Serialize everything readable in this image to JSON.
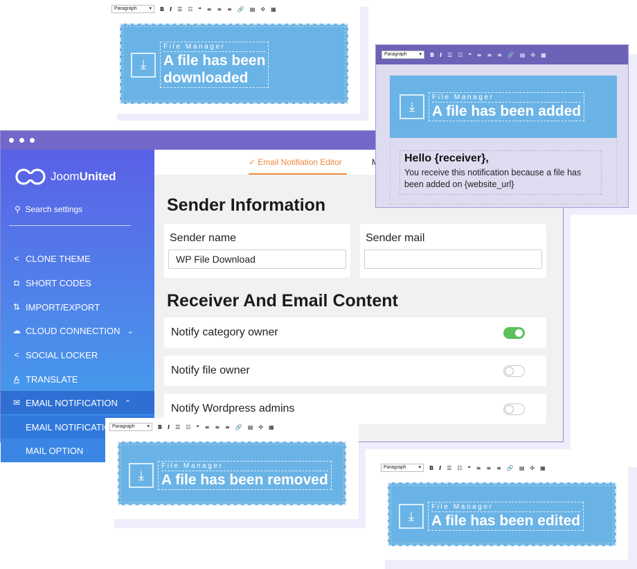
{
  "toolbar": {
    "paragraph_label": "Paragraph",
    "bold": "B",
    "italic": "I",
    "ul": "☰",
    "ol": "☷",
    "quote": "❝",
    "align_left": "≡",
    "align_center": "≡",
    "align_right": "≡",
    "link": "🔗",
    "hr": "▤",
    "fullscreen": "✣",
    "table": "▦"
  },
  "banners": {
    "downloaded": {
      "subtitle": "File Manager",
      "title_line1": "A file has been",
      "title_line2": "downloaded"
    },
    "added": {
      "subtitle": "File Manager",
      "title": "A file has been added",
      "greeting": "Hello {receiver},",
      "body": "You receive this notification because a file has been added on {website_url}"
    },
    "removed": {
      "subtitle": "File Manager",
      "title": "A file has been removed"
    },
    "edited": {
      "subtitle": "File Manager",
      "title": "A file has been edited"
    }
  },
  "app": {
    "logo": {
      "brand_light": "Joom",
      "brand_bold": "United"
    },
    "search_placeholder": "Search settings",
    "nav": [
      {
        "label": "CLONE THEME",
        "icon": "share-icon"
      },
      {
        "label": "SHORT CODES",
        "icon": "shortcode-icon"
      },
      {
        "label": "IMPORT/EXPORT",
        "icon": "import-export-icon"
      },
      {
        "label": "CLOUD CONNECTION",
        "icon": "cloud-icon"
      },
      {
        "label": "SOCIAL LOCKER",
        "icon": "share-icon"
      },
      {
        "label": "TRANSLATE",
        "icon": "translate-icon"
      },
      {
        "label": "EMAIL NOTIFICATION",
        "icon": "mail-icon"
      },
      {
        "label": "EMAIL NOTIFICATION EDITOR"
      },
      {
        "label": "MAIL OPTION"
      }
    ],
    "tabs": {
      "active": "Email Notifiation Editor",
      "next": "M"
    },
    "sender_heading": "Sender Information",
    "sender_name_label": "Sender name",
    "sender_name_value": "WP File Download",
    "sender_mail_label": "Sender mail",
    "sender_mail_value": "",
    "receiver_heading": "Receiver And Email Content",
    "toggles": [
      {
        "label": "Notify category owner",
        "on": true
      },
      {
        "label": "Notify file owner",
        "on": false
      },
      {
        "label": "Notify Wordpress admins",
        "on": false
      }
    ]
  },
  "colors": {
    "sidebar_top": "#5a60e6",
    "sidebar_bottom": "#3fa2ec",
    "accent_orange": "#f0873a",
    "toggle_on": "#5cc05c",
    "banner_blue": "#6ab3e6",
    "titlebar": "#7268c9"
  }
}
